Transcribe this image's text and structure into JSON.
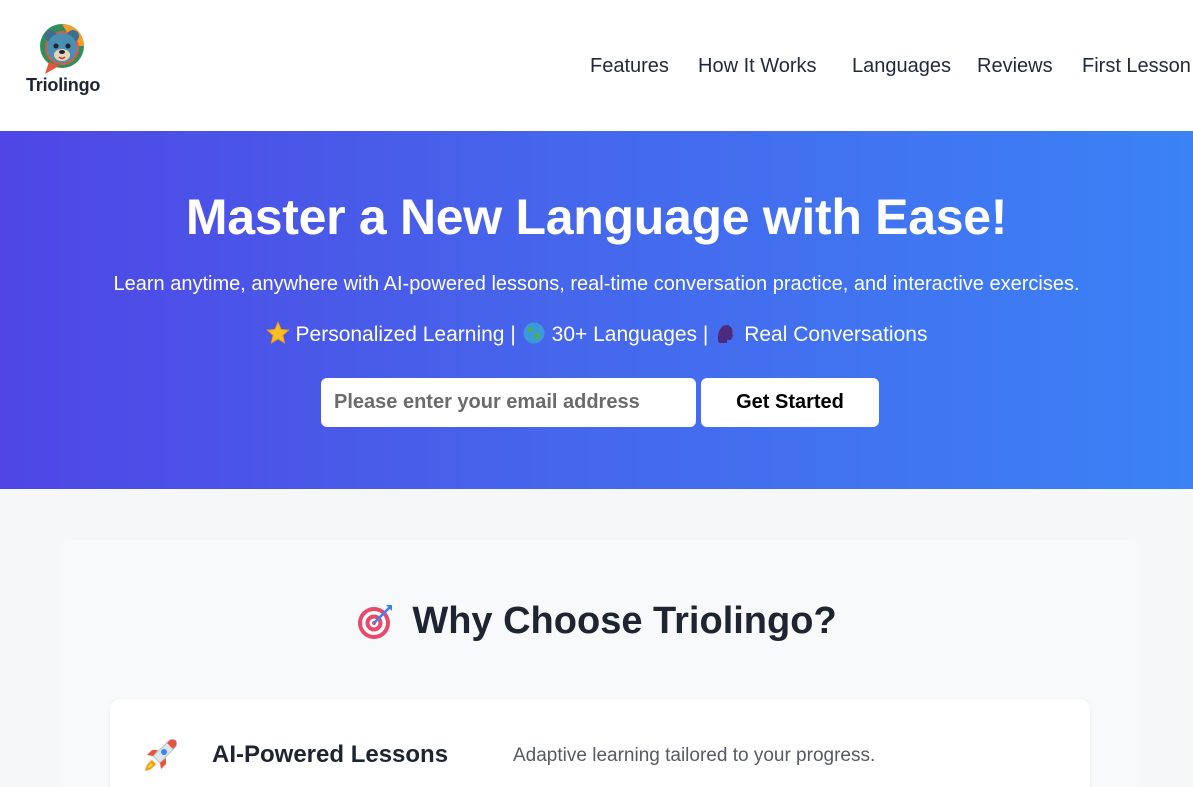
{
  "header": {
    "brand_name": "Triolingo",
    "logo_icon": "bear-chat-bubble-icon",
    "nav": [
      {
        "label": "Features"
      },
      {
        "label": "How It Works"
      },
      {
        "label": "Languages"
      },
      {
        "label": "Reviews"
      },
      {
        "label": "First Lesson"
      }
    ]
  },
  "hero": {
    "title": "Master a New Language with Ease!",
    "subtitle": "Learn anytime, anywhere with AI-powered lessons, real-time conversation practice, and interactive exercises.",
    "highlights": [
      {
        "icon": "star-icon",
        "label": "Personalized Learning"
      },
      {
        "icon": "globe-icon",
        "label": "30+ Languages"
      },
      {
        "icon": "speaking-head-icon",
        "label": "Real Conversations"
      }
    ],
    "separator": "|",
    "email_placeholder": "Please enter your email address",
    "cta_label": "Get Started",
    "gradient_start": "#4f46e5",
    "gradient_end": "#3b82f6"
  },
  "features": {
    "heading_icon": "target-icon",
    "heading": "Why Choose Triolingo?",
    "items": [
      {
        "icon": "rocket-icon",
        "title": "AI-Powered Lessons",
        "description": "Adaptive learning tailored to your progress."
      }
    ]
  }
}
